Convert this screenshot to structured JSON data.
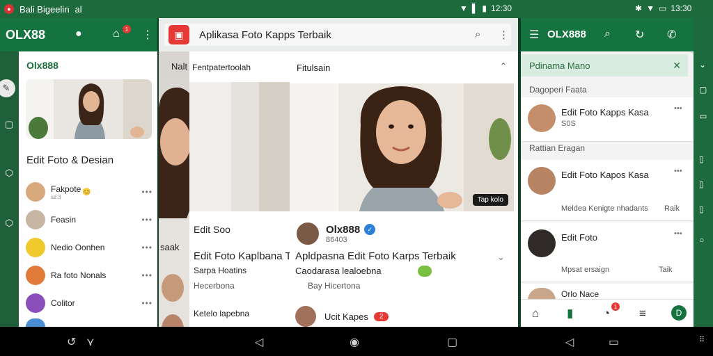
{
  "status_bar": {
    "left_text": "Bali Bigeelin",
    "left_extra": "al",
    "time": "12:30",
    "time_right": "13:30"
  },
  "panel_left": {
    "app_logo": "OLX88",
    "brand": "Olx888",
    "section_title": "Edit Foto & Desian",
    "notif_count": "1",
    "contacts": [
      {
        "name": "Fakpote",
        "sub": "sz:3",
        "emoji": "😊"
      },
      {
        "name": "Feasin",
        "sub": ""
      },
      {
        "name": "Nedio Oonhen",
        "sub": ""
      },
      {
        "name": "Ra foto Nonals",
        "sub": ""
      },
      {
        "name": "Colitor",
        "sub": ""
      }
    ]
  },
  "panel_middle": {
    "search_title": "Aplikasa Foto Kapps Terbaik",
    "back_tab_label": "Nalt",
    "back_card_caption": "Fentpatertoolah",
    "front_card_caption": "Fitulsain",
    "photo_chip": "Tap kolo",
    "back_item_title": "Edit Soo",
    "back_item_title2": "Edit Foto Kaplbana Te",
    "back_item_sub": "Sarpa Hoatins",
    "back_item_meta": "Hecerbona",
    "left_strip_label": "saak",
    "back_item_bottom": "Ketelo lapebna",
    "profile_name": "Olx888",
    "profile_handle": "86403",
    "post_title": "Apldpasna Edit Foto Karps Terbaik",
    "post_sub": "Caodarasa lealoebna",
    "post_meta": "Bay Hicertona",
    "bottom_item": "Ucit Kapes",
    "bottom_badge": "2"
  },
  "panel_right": {
    "title": "OLX888",
    "banner": "Pdinama Mano",
    "sections": [
      "Dagoperi Faata",
      "Rattian Eragan"
    ],
    "chats": [
      {
        "name": "Edit Foto Kapps Kasa",
        "meta": "S0S"
      },
      {
        "name": "Edit Foto Kapos Kasa",
        "meta": "Meldea Kenigte nhadants",
        "tail": "Raik"
      },
      {
        "name": "Edit Foto",
        "meta": "Mpsat ersaign",
        "tail": "Taik"
      },
      {
        "name": "Orlo Nace",
        "meta": ""
      }
    ],
    "bottom_badge": "1"
  }
}
